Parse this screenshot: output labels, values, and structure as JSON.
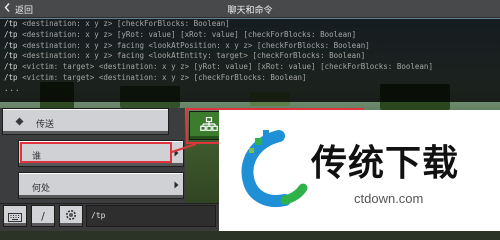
{
  "topbar": {
    "back_label": "返回",
    "title": "聊天和命令"
  },
  "history": {
    "lines": [
      {
        "cmd": "/tp",
        "args": "<destination: x y z> [checkForBlocks: Boolean]"
      },
      {
        "cmd": "/tp",
        "args": "<destination: x y z> [yRot: value] [xRot: value] [checkForBlocks: Boolean]"
      },
      {
        "cmd": "/tp",
        "args": "<destination: x y z> facing <lookAtPosition: x y z> [checkForBlocks: Boolean]"
      },
      {
        "cmd": "/tp",
        "args": "<destination: x y z> facing <lookAtEntity: target> [checkForBlocks: Boolean]"
      },
      {
        "cmd": "/tp",
        "args": "<victim: target> <destination: x y z> [yRot: value] [xRot: value] [checkForBlocks: Boolean]"
      },
      {
        "cmd": "/tp",
        "args": "<victim: target> <destination: x y z> [checkForBlocks: Boolean]"
      }
    ],
    "more": "..."
  },
  "menu": {
    "teleport_label": "传送",
    "who_label": "谁",
    "where_label": "何处"
  },
  "chatbar": {
    "slash_label": "/",
    "input_value": "/tp"
  },
  "watermark": {
    "title": "传统下载",
    "url": "ctdown.com"
  },
  "colors": {
    "highlight": "#e0343c",
    "accent_green": "#3b7c2f"
  },
  "icons": {
    "back": "chevron-left-icon",
    "teleport": "diamond-icon",
    "green_button": "sitemap-icon",
    "keyboard": "keyboard-icon",
    "settings": "gear-icon"
  }
}
